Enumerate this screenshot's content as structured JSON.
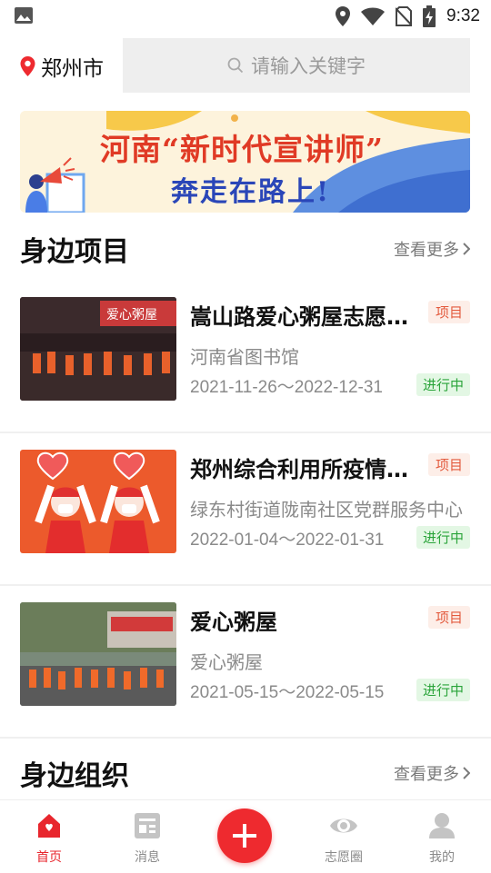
{
  "status_bar": {
    "time": "9:32"
  },
  "header": {
    "city": "郑州市",
    "search_placeholder": "请输入关键字"
  },
  "banner": {
    "line1": "河南“新时代宣讲师”",
    "line2": "奔走在路上!"
  },
  "section_nearby_projects": {
    "title": "身边项目",
    "more": "查看更多"
  },
  "projects": [
    {
      "title": "嵩山路爱心粥屋志愿...",
      "tag": "项目",
      "org": "河南省图书馆",
      "date": "2021-11-26～2022-12-31",
      "status": "进行中"
    },
    {
      "title": "郑州综合利用所疫情...",
      "tag": "项目",
      "org": "绿东村街道陇南社区党群服务中心",
      "date": "2022-01-04～2022-01-31",
      "status": "进行中"
    },
    {
      "title": "爱心粥屋",
      "tag": "项目",
      "org": "爱心粥屋",
      "date": "2021-05-15～2022-05-15",
      "status": "进行中"
    }
  ],
  "section_nearby_orgs": {
    "title": "身边组织",
    "more": "查看更多"
  },
  "tabbar": {
    "home": "首页",
    "messages": "消息",
    "circle": "志愿圈",
    "mine": "我的"
  },
  "colors": {
    "accent": "#e8262d",
    "tag_text": "#e35b3e",
    "status_text": "#2aa43a"
  },
  "thumb_sign": "爱心粥屋"
}
